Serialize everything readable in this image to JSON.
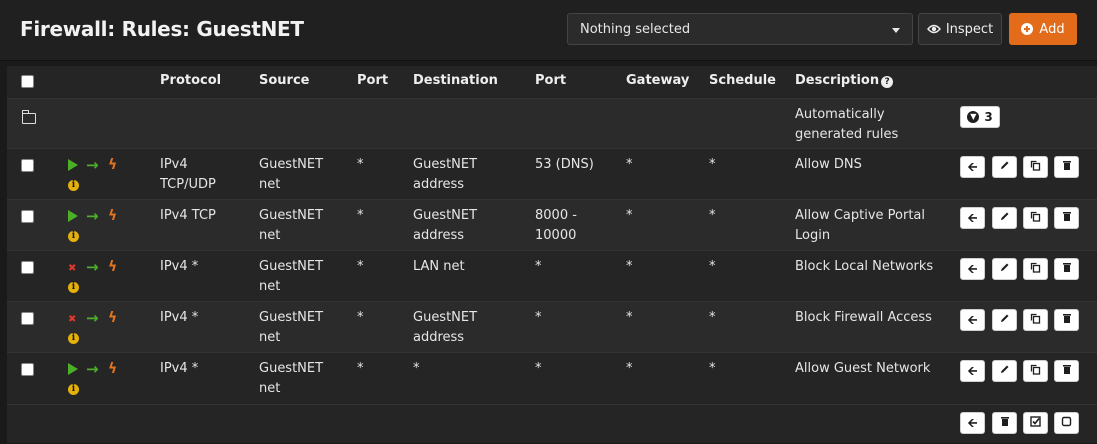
{
  "page": {
    "title": "Firewall: Rules: GuestNET",
    "select_placeholder": "Nothing selected",
    "inspect_label": "Inspect",
    "add_label": "Add"
  },
  "table": {
    "headers": [
      "Protocol",
      "Source",
      "Port",
      "Destination",
      "Port",
      "Gateway",
      "Schedule",
      "Description"
    ],
    "auto_group": {
      "description_line1": "Automatically",
      "description_line2": "generated rules",
      "count": "3"
    },
    "rows": [
      {
        "action": "pass",
        "protocol": [
          "IPv4",
          "TCP/UDP"
        ],
        "source": [
          "GuestNET",
          "net"
        ],
        "src_port": "*",
        "destination": [
          "GuestNET",
          "address"
        ],
        "dst_port": [
          "53 (DNS)",
          ""
        ],
        "gateway": "*",
        "schedule": "*",
        "description": [
          "Allow DNS",
          ""
        ]
      },
      {
        "action": "pass",
        "protocol": [
          "IPv4 TCP",
          ""
        ],
        "source": [
          "GuestNET",
          "net"
        ],
        "src_port": "*",
        "destination": [
          "GuestNET",
          "address"
        ],
        "dst_port": [
          "8000 -",
          "10000"
        ],
        "gateway": "*",
        "schedule": "*",
        "description": [
          "Allow Captive Portal",
          "Login"
        ]
      },
      {
        "action": "block",
        "protocol": [
          "IPv4 *",
          ""
        ],
        "source": [
          "GuestNET",
          "net"
        ],
        "src_port": "*",
        "destination": [
          "LAN net",
          ""
        ],
        "dst_port": [
          "*",
          ""
        ],
        "gateway": "*",
        "schedule": "*",
        "description": [
          "Block Local Networks",
          ""
        ]
      },
      {
        "action": "block",
        "protocol": [
          "IPv4 *",
          ""
        ],
        "source": [
          "GuestNET",
          "net"
        ],
        "src_port": "*",
        "destination": [
          "GuestNET",
          "address"
        ],
        "dst_port": [
          "*",
          ""
        ],
        "gateway": "*",
        "schedule": "*",
        "description": [
          "Block Firewall Access",
          ""
        ]
      },
      {
        "action": "pass",
        "protocol": [
          "IPv4 *",
          ""
        ],
        "source": [
          "GuestNET",
          "net"
        ],
        "src_port": "*",
        "destination": [
          "*",
          ""
        ],
        "dst_port": [
          "*",
          ""
        ],
        "gateway": "*",
        "schedule": "*",
        "description": [
          "Allow Guest Network",
          ""
        ]
      }
    ]
  },
  "icons": {
    "pass": "play-icon",
    "block": "times-icon",
    "direction": "arrow-right-icon",
    "quick": "bolt-icon",
    "info": "info-circle-icon",
    "row_actions": [
      "anchor-arrow-icon",
      "pencil-icon",
      "copy-icon",
      "trash-icon"
    ],
    "footer_actions": [
      "anchor-arrow-icon",
      "trash-icon",
      "check-square-icon",
      "square-icon"
    ]
  },
  "colors": {
    "accent": "#e36c1b",
    "pass": "#4caf28",
    "block": "#e0362b",
    "quick": "#e5731e",
    "info": "#e4b10b"
  }
}
